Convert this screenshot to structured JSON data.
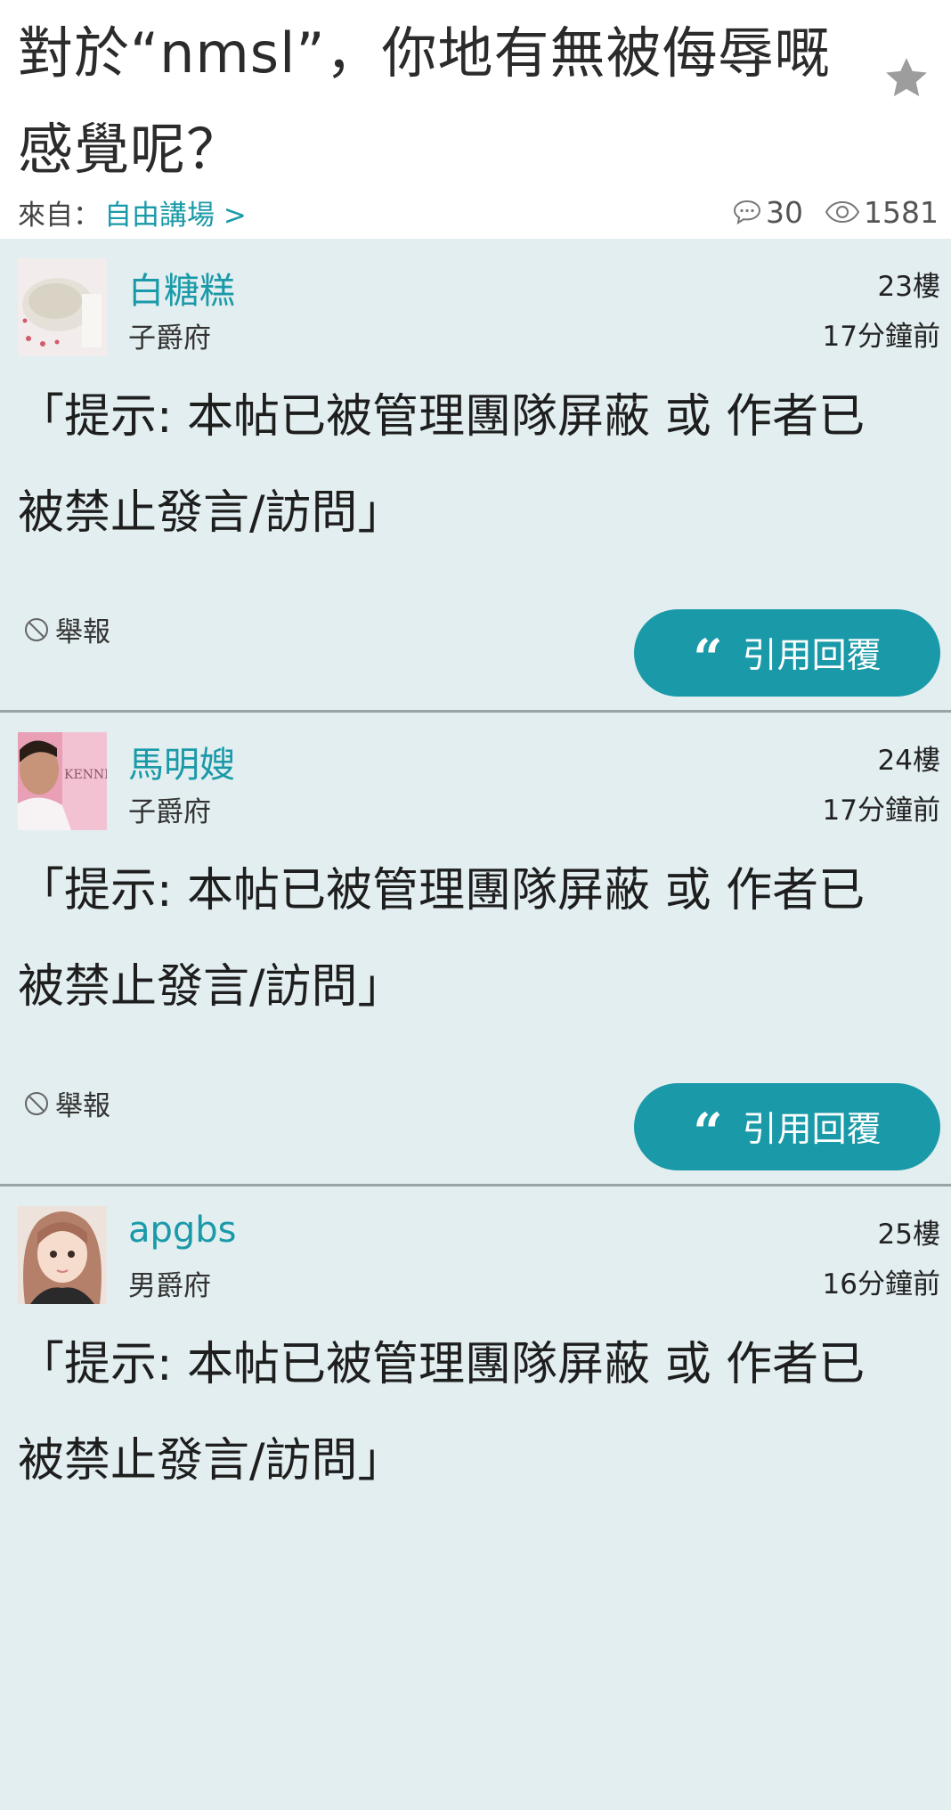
{
  "thread": {
    "title": "對於“nmsl”，你地有無被侮辱嘅感覺呢？",
    "from_label": "來自：",
    "board": "自由講場 >",
    "reply_count": "30",
    "view_count": "1581"
  },
  "posts": [
    {
      "username": "白糖糕",
      "rank": "子爵府",
      "floor": "23樓",
      "time": "17分鐘前",
      "content": "「提示: 本帖已被管理團隊屏蔽 或 作者已被禁止發言/訪問」",
      "report_label": "舉報",
      "quote_label": "引用回覆",
      "avatar_icon": "cake-photo"
    },
    {
      "username": "馬明嫂",
      "rank": "子爵府",
      "floor": "24樓",
      "time": "17分鐘前",
      "content": "「提示: 本帖已被管理團隊屏蔽 或 作者已被禁止發言/訪問」",
      "report_label": "舉報",
      "quote_label": "引用回覆",
      "avatar_icon": "man-photo"
    },
    {
      "username": "apgbs",
      "rank": "男爵府",
      "floor": "25樓",
      "time": "16分鐘前",
      "content": "「提示: 本帖已被管理團隊屏蔽 或 作者已被禁止發言/訪問」",
      "avatar_icon": "girl-photo"
    }
  ],
  "colors": {
    "accent": "#1a9aa8",
    "post_background": "#e3eef0",
    "divider": "#9aa3a5"
  }
}
